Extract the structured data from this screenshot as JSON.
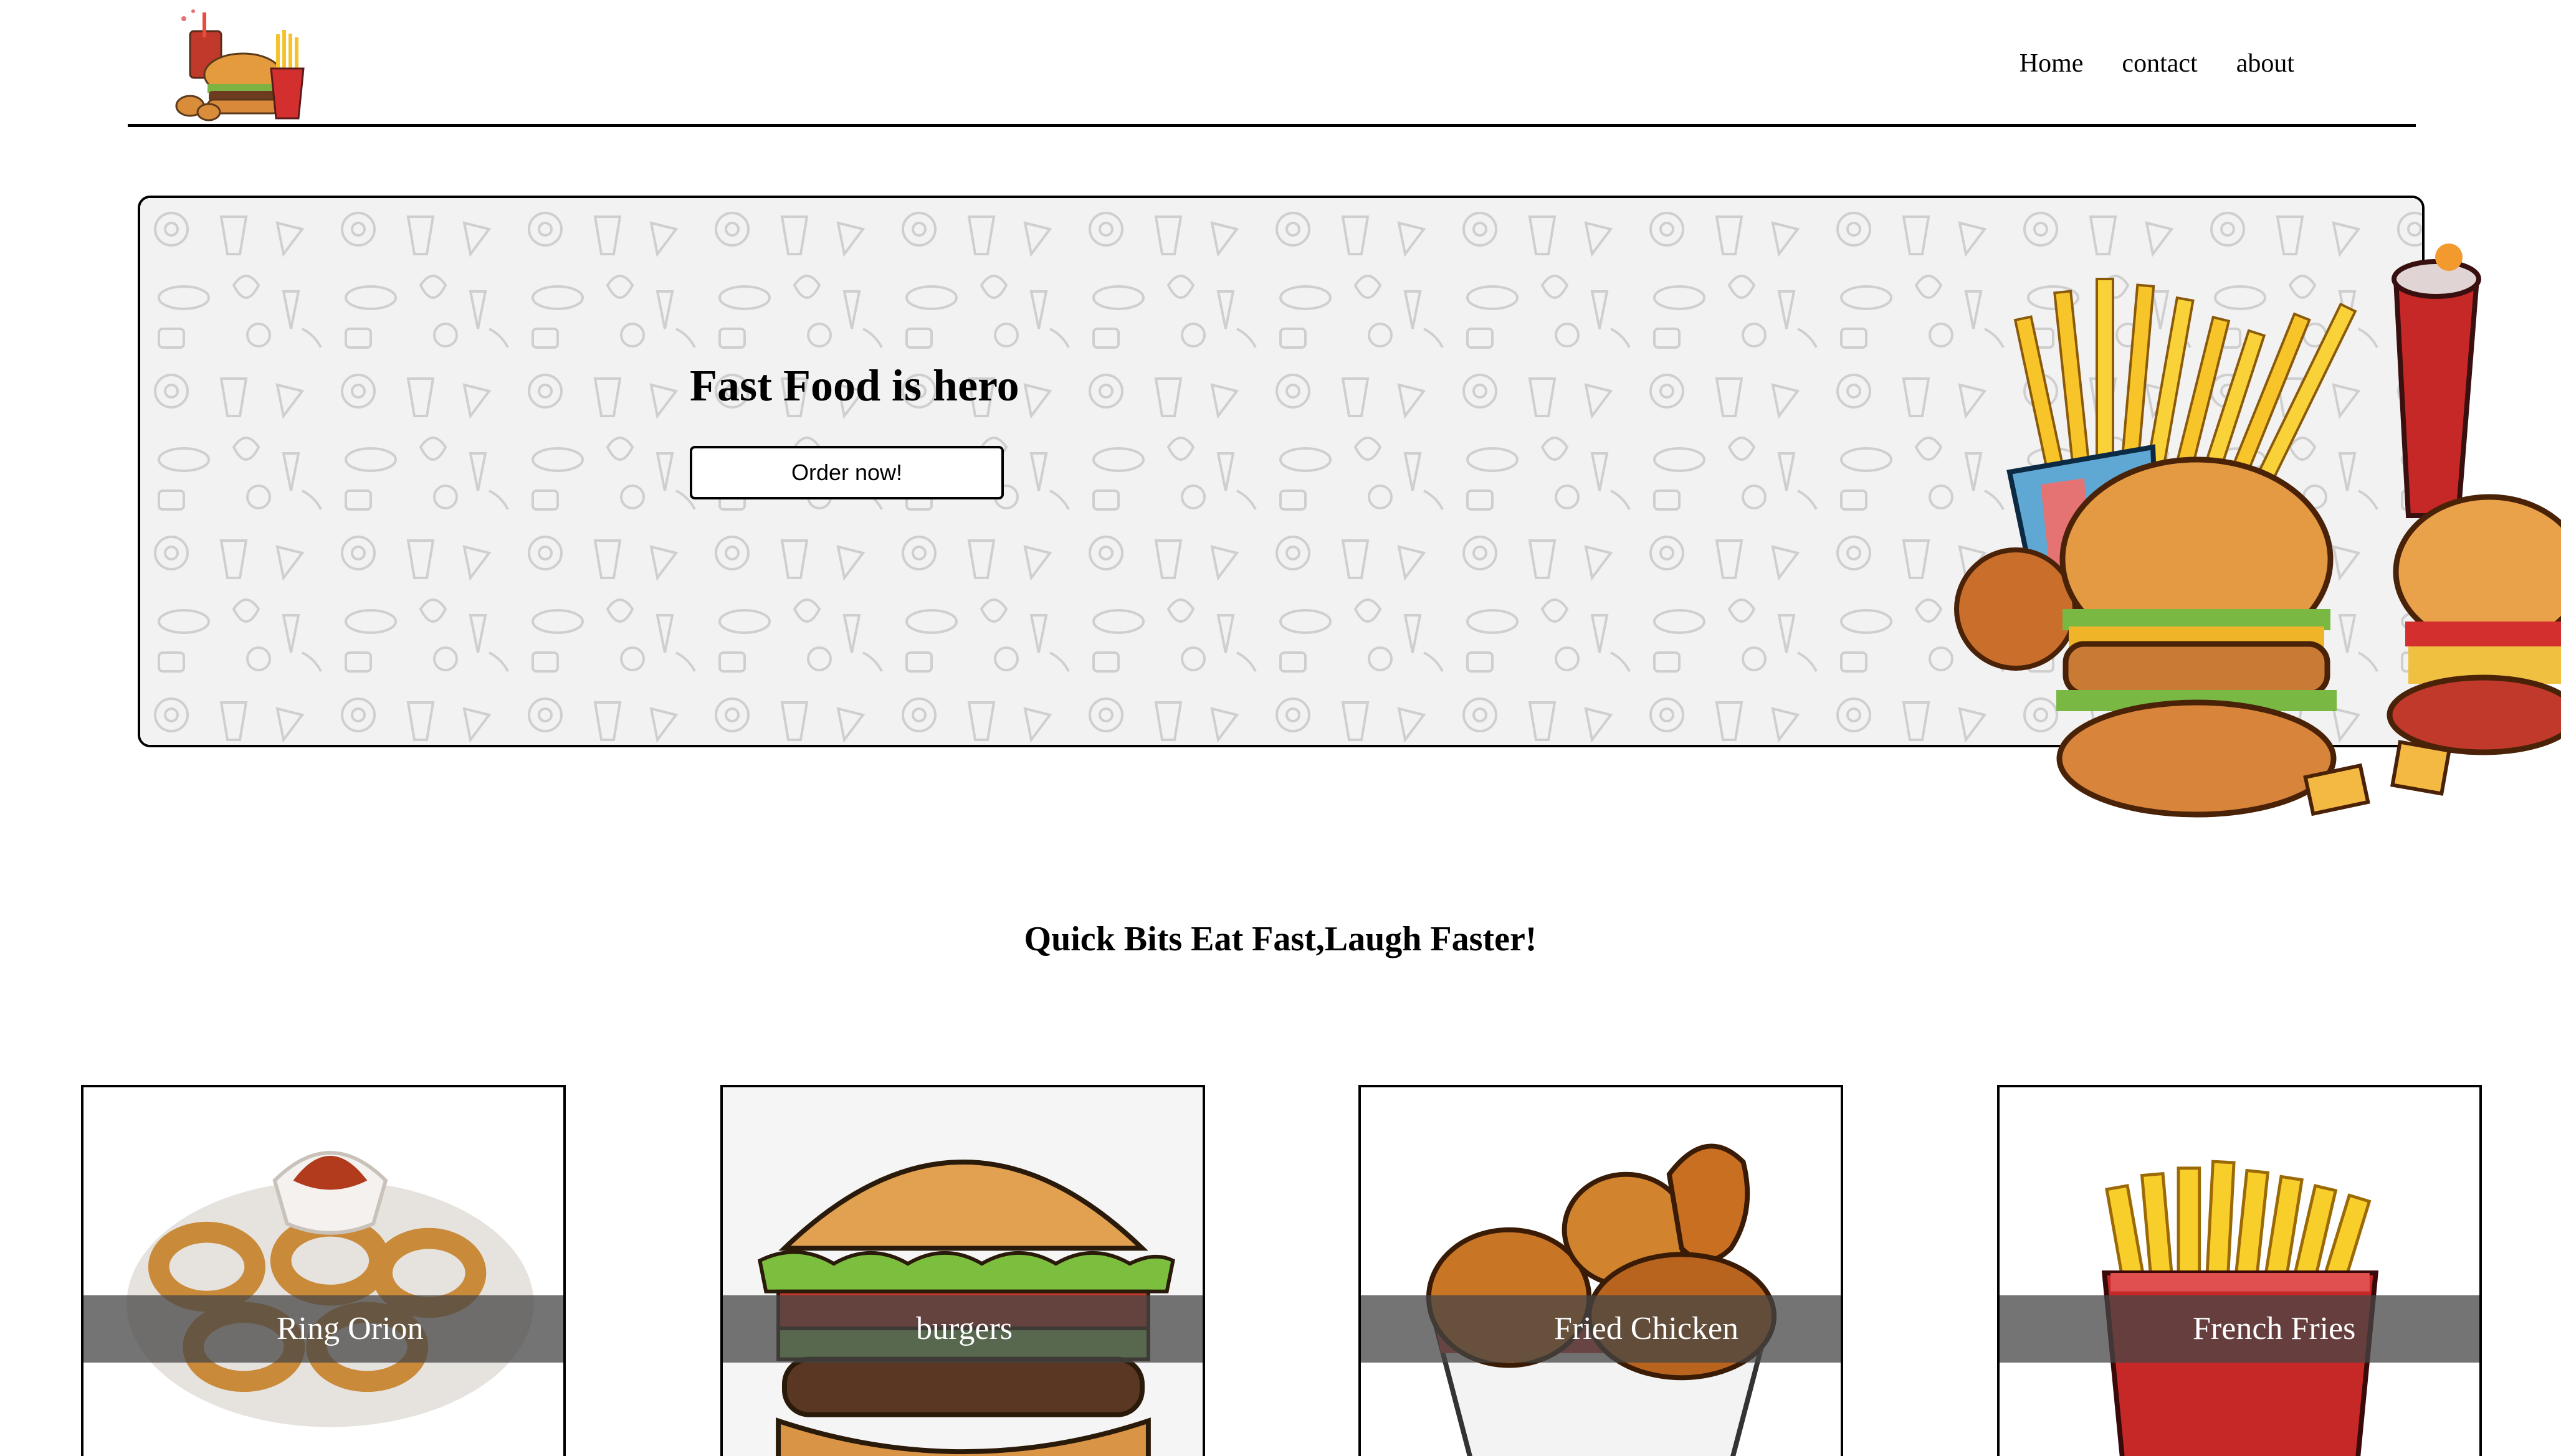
{
  "nav": {
    "items": [
      {
        "label": "Home"
      },
      {
        "label": "contact"
      },
      {
        "label": "about"
      }
    ]
  },
  "hero": {
    "title": "Fast Food is hero",
    "button_label": "Order now!"
  },
  "tagline": "Quick Bits Eat Fast,Laugh Faster!",
  "cards": [
    {
      "label": "Ring Orion"
    },
    {
      "label": "burgers"
    },
    {
      "label": "Fried Chicken"
    },
    {
      "label": "French Fries"
    }
  ],
  "colors": {
    "page_bg": "#ffffff",
    "border": "#000000",
    "hero_pattern_bg": "#f2f2f2",
    "card_label_band": "#464646",
    "card_label_text": "#ffffff"
  },
  "icons": [
    "fast-food-logo-icon"
  ]
}
